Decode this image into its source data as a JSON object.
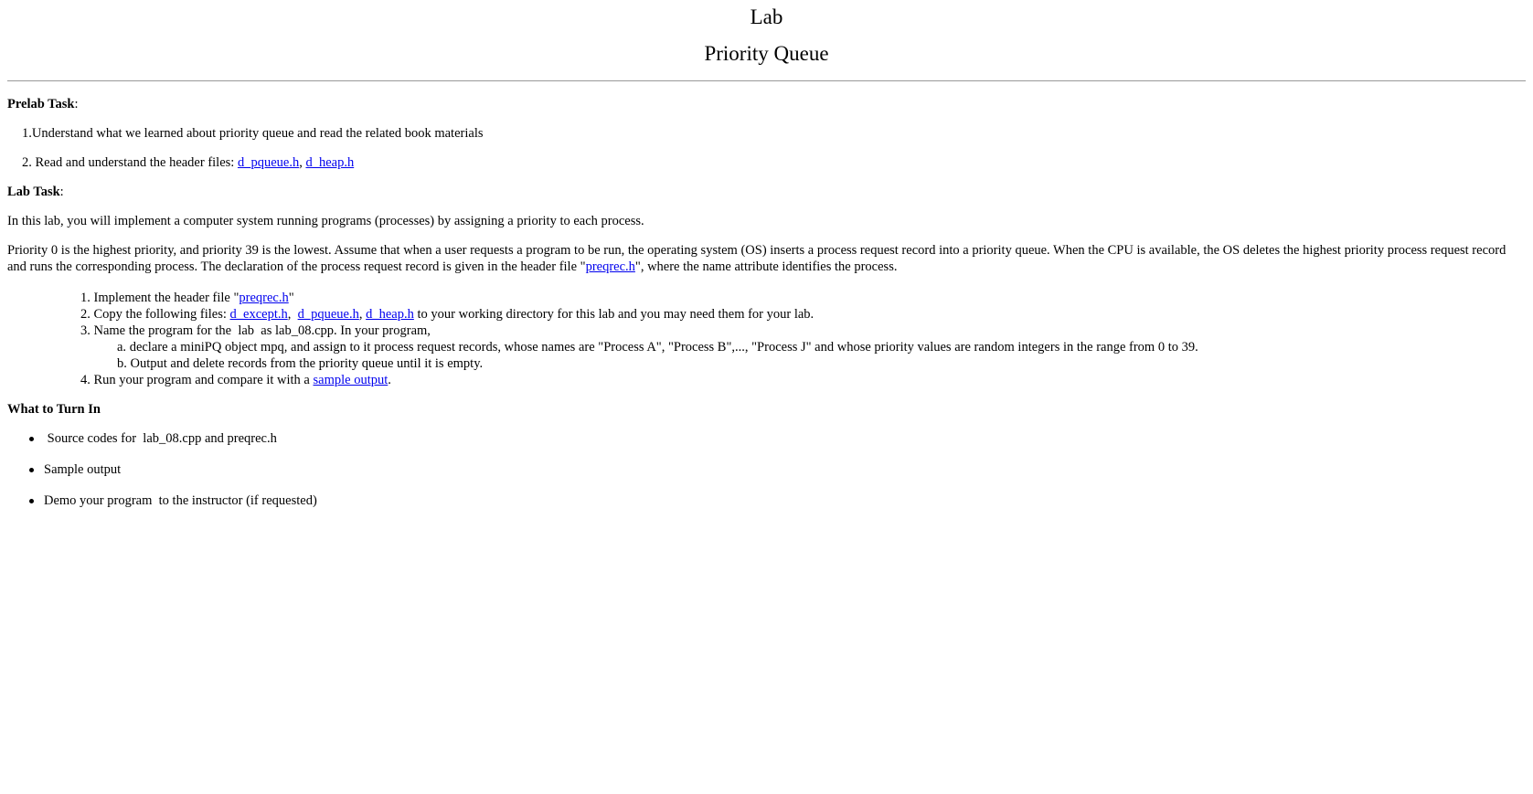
{
  "header": {
    "title": "Lab",
    "subtitle": "Priority Queue"
  },
  "prelab": {
    "heading": "Prelab Task",
    "colon": ":",
    "item1": "1.Understand what we learned about priority queue and read the related book materials",
    "item2_prefix": "2. Read and understand the header files: ",
    "link_pqueue": "d_pqueue.h",
    "comma": ", ",
    "link_heap": "d_heap.h"
  },
  "lab": {
    "heading": "Lab Task",
    "colon": ":",
    "intro": "In this lab, you will implement a computer system running programs (processes) by assigning a priority to each process.",
    "desc_part1": "Priority 0 is the highest priority, and priority 39 is the lowest. Assume that when a user requests a program to be run, the operating system (OS)  inserts a process request record into a priority queue. When the CPU is available, the OS deletes the highest priority process request record and runs the corresponding process. The declaration of the process request record is given in the header file \"",
    "desc_link": "preqrec.h",
    "desc_part2": "\", where the name attribute identifies the process.",
    "steps": {
      "s1_num": "1.",
      "s1_prefix": " Implement the header file \"",
      "s1_link": "preqrec.h",
      "s1_suffix": "\"",
      "s2_num": "2.",
      "s2_prefix": " Copy the following files: ",
      "s2_link1": "d_except.h",
      "s2_sep1": ",  ",
      "s2_link2": "d_pqueue.h",
      "s2_sep2": ", ",
      "s2_link3": "d_heap.h",
      "s2_suffix": " to your working directory for this lab and you may need them for your lab.",
      "s3_num": "3.",
      "s3_text": " Name the program for the  lab  as lab_08.cpp. In your program,",
      "s3a_num": "a.",
      "s3a_text": " declare a miniPQ object mpq, and assign to it process request records, whose names are \"Process A\", \"Process B\",..., \"Process J\" and whose priority values are random integers in the range from 0 to 39.",
      "s3b_num": "b.",
      "s3b_text": " Output and delete records from the priority queue until it is empty.",
      "s4_num": "4.",
      "s4_prefix": " Run your program and compare it with a ",
      "s4_link": "sample output",
      "s4_suffix": "."
    }
  },
  "turnin": {
    "heading": "What to Turn In",
    "items": [
      " Source codes for  lab_08.cpp and preqrec.h",
      "Sample output",
      "Demo your program  to the instructor (if requested)"
    ]
  }
}
